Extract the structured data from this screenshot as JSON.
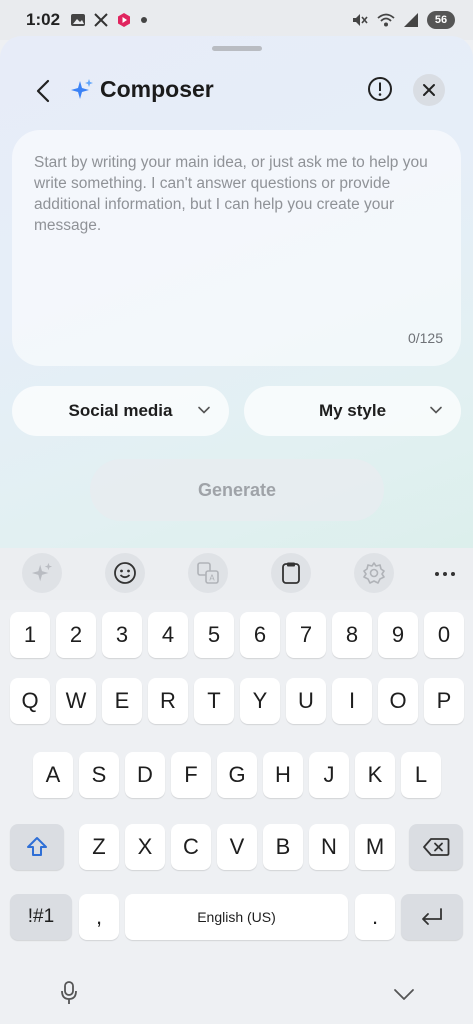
{
  "status_bar": {
    "time": "1:02",
    "battery": "56",
    "left_icons": [
      "image-icon",
      "x-app-icon",
      "record-icon",
      "dot-icon"
    ],
    "right_icons": [
      "mute-icon",
      "wifi-icon",
      "signal-icon",
      "battery-icon"
    ]
  },
  "composer": {
    "title": "Composer",
    "input": {
      "placeholder": "Start by writing your main idea, or just ask me to help you write something. I can't answer questions or provide additional information, but I can help you create your message.",
      "value": "",
      "char_count": "0/125"
    },
    "type_select": {
      "value": "Social media"
    },
    "style_select": {
      "value": "My style"
    },
    "generate_label": "Generate"
  },
  "keyboard": {
    "toolbar": [
      "sparkle-icon",
      "emoji-icon",
      "translate-icon",
      "clipboard-icon",
      "settings-icon",
      "more-icon"
    ],
    "rows": {
      "numbers": [
        "1",
        "2",
        "3",
        "4",
        "5",
        "6",
        "7",
        "8",
        "9",
        "0"
      ],
      "row1": [
        "Q",
        "W",
        "E",
        "R",
        "T",
        "Y",
        "U",
        "I",
        "O",
        "P"
      ],
      "row2": [
        "A",
        "S",
        "D",
        "F",
        "G",
        "H",
        "J",
        "K",
        "L"
      ],
      "row3": [
        "Z",
        "X",
        "C",
        "V",
        "B",
        "N",
        "M"
      ]
    },
    "symbols_label": "!#1",
    "comma_label": ",",
    "space_label": "English (US)",
    "period_label": "."
  },
  "colors": {
    "accent": "#3b82f6",
    "shift_key": "#2f6fd6",
    "record_icon": "#e0245e"
  }
}
